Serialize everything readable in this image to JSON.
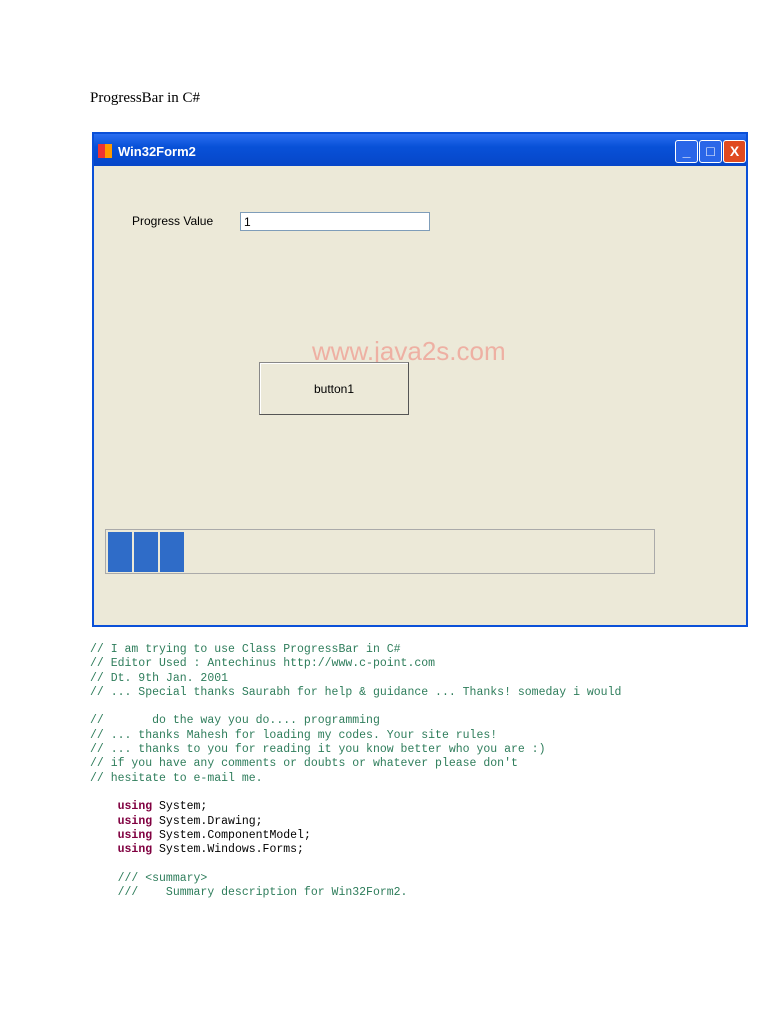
{
  "heading": "ProgressBar in C#",
  "window": {
    "title": "Win32Form2",
    "minimize": "_",
    "maximize": "□",
    "close": "X"
  },
  "form": {
    "label": "Progress Value",
    "input_value": "1",
    "watermark": "www.java2s.com",
    "button": "button1"
  },
  "progress": {
    "blocks_filled": 3,
    "percent": 14
  },
  "code": {
    "comments": [
      "// I am trying to use Class ProgressBar in C#",
      "// Editor Used : Antechinus http://www.c-point.com",
      "// Dt. 9th Jan. 2001",
      "// ... Special thanks Saurabh for help & guidance ... Thanks! someday i would",
      "",
      "//       do the way you do.... programming",
      "// ... thanks Mahesh for loading my codes. Your site rules!",
      "// ... thanks to you for reading it you know better who you are :)",
      "// if you have any comments or doubts or whatever please don't",
      "// hesitate to e-mail me."
    ],
    "keyword": "using",
    "usings": [
      " System;",
      " System.Drawing;",
      " System.ComponentModel;",
      " System.Windows.Forms;"
    ],
    "summary": [
      "    /// <summary>",
      "    ///    Summary description for Win32Form2."
    ]
  }
}
